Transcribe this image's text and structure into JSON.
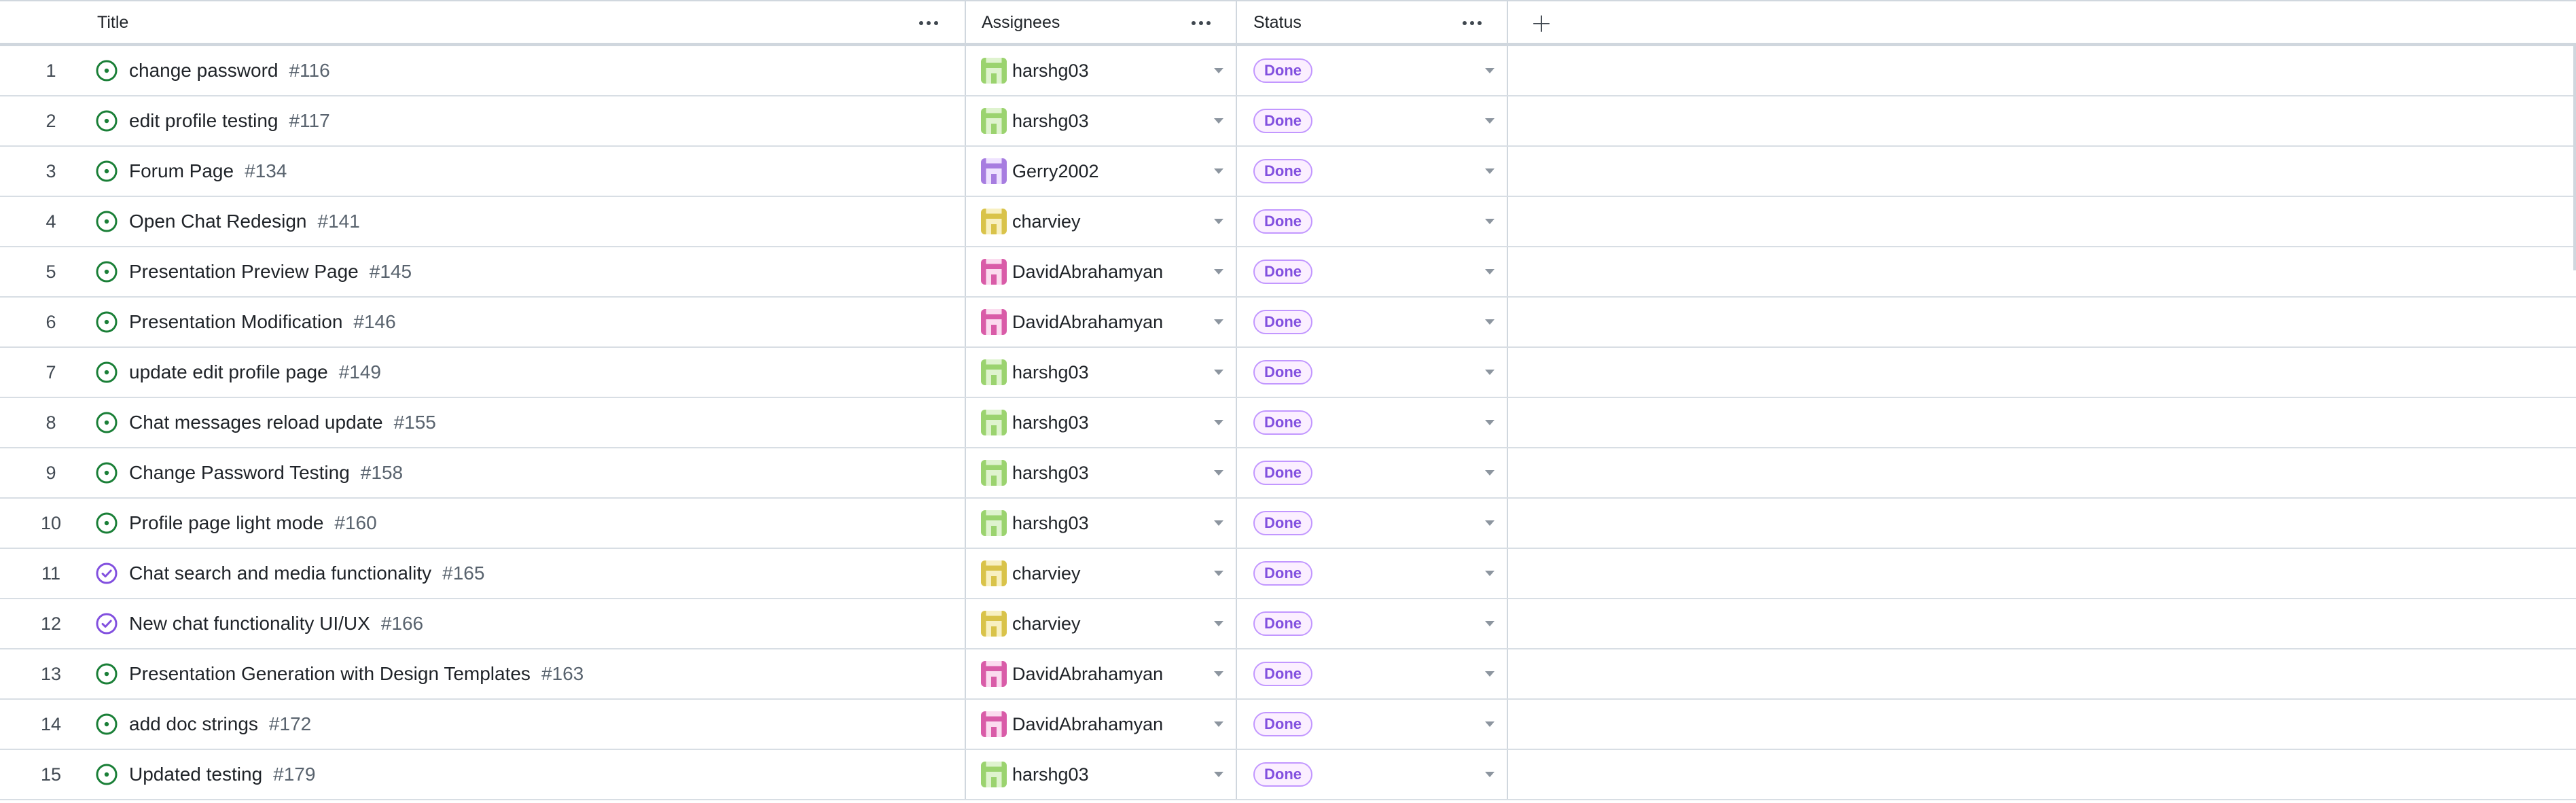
{
  "header": {
    "title_label": "Title",
    "assignees_label": "Assignees",
    "status_label": "Status",
    "add_column_symbol": "+"
  },
  "colors": {
    "open_issue": "#1a7f37",
    "closed_issue": "#8250df",
    "done_badge_text": "#8250df",
    "done_badge_bg": "#fbefff",
    "done_badge_border": "#c297ff"
  },
  "rows": [
    {
      "num": "1",
      "title": "change password",
      "issue": "#116",
      "assignee": "harshg03",
      "avatar": "green",
      "state_icon": "open-issue-icon",
      "status": "Done"
    },
    {
      "num": "2",
      "title": "edit profile testing",
      "issue": "#117",
      "assignee": "harshg03",
      "avatar": "green",
      "state_icon": "open-issue-icon",
      "status": "Done"
    },
    {
      "num": "3",
      "title": "Forum Page",
      "issue": "#134",
      "assignee": "Gerry2002",
      "avatar": "purple",
      "state_icon": "open-issue-icon",
      "status": "Done"
    },
    {
      "num": "4",
      "title": "Open Chat Redesign",
      "issue": "#141",
      "assignee": "charviey",
      "avatar": "yellow",
      "state_icon": "open-issue-icon",
      "status": "Done"
    },
    {
      "num": "5",
      "title": "Presentation Preview Page",
      "issue": "#145",
      "assignee": "DavidAbrahamyan",
      "avatar": "pink",
      "state_icon": "open-issue-icon",
      "status": "Done"
    },
    {
      "num": "6",
      "title": "Presentation Modification",
      "issue": "#146",
      "assignee": "DavidAbrahamyan",
      "avatar": "pink",
      "state_icon": "open-issue-icon",
      "status": "Done"
    },
    {
      "num": "7",
      "title": "update edit profile page",
      "issue": "#149",
      "assignee": "harshg03",
      "avatar": "green",
      "state_icon": "open-issue-icon",
      "status": "Done"
    },
    {
      "num": "8",
      "title": "Chat messages reload update",
      "issue": "#155",
      "assignee": "harshg03",
      "avatar": "green",
      "state_icon": "open-issue-icon",
      "status": "Done"
    },
    {
      "num": "9",
      "title": "Change Password Testing",
      "issue": "#158",
      "assignee": "harshg03",
      "avatar": "green",
      "state_icon": "open-issue-icon",
      "status": "Done"
    },
    {
      "num": "10",
      "title": "Profile page light mode",
      "issue": "#160",
      "assignee": "harshg03",
      "avatar": "green",
      "state_icon": "open-issue-icon",
      "status": "Done"
    },
    {
      "num": "11",
      "title": "Chat search and media functionality",
      "issue": "#165",
      "assignee": "charviey",
      "avatar": "yellow",
      "state_icon": "closed-issue-icon",
      "status": "Done"
    },
    {
      "num": "12",
      "title": "New chat functionality UI/UX",
      "issue": "#166",
      "assignee": "charviey",
      "avatar": "yellow",
      "state_icon": "closed-issue-icon",
      "status": "Done"
    },
    {
      "num": "13",
      "title": "Presentation Generation with Design Templates",
      "issue": "#163",
      "assignee": "DavidAbrahamyan",
      "avatar": "pink",
      "state_icon": "open-issue-icon",
      "status": "Done"
    },
    {
      "num": "14",
      "title": "add doc strings",
      "issue": "#172",
      "assignee": "DavidAbrahamyan",
      "avatar": "pink",
      "state_icon": "open-issue-icon",
      "status": "Done"
    },
    {
      "num": "15",
      "title": "Updated testing",
      "issue": "#179",
      "assignee": "harshg03",
      "avatar": "green",
      "state_icon": "open-issue-icon",
      "status": "Done"
    }
  ]
}
